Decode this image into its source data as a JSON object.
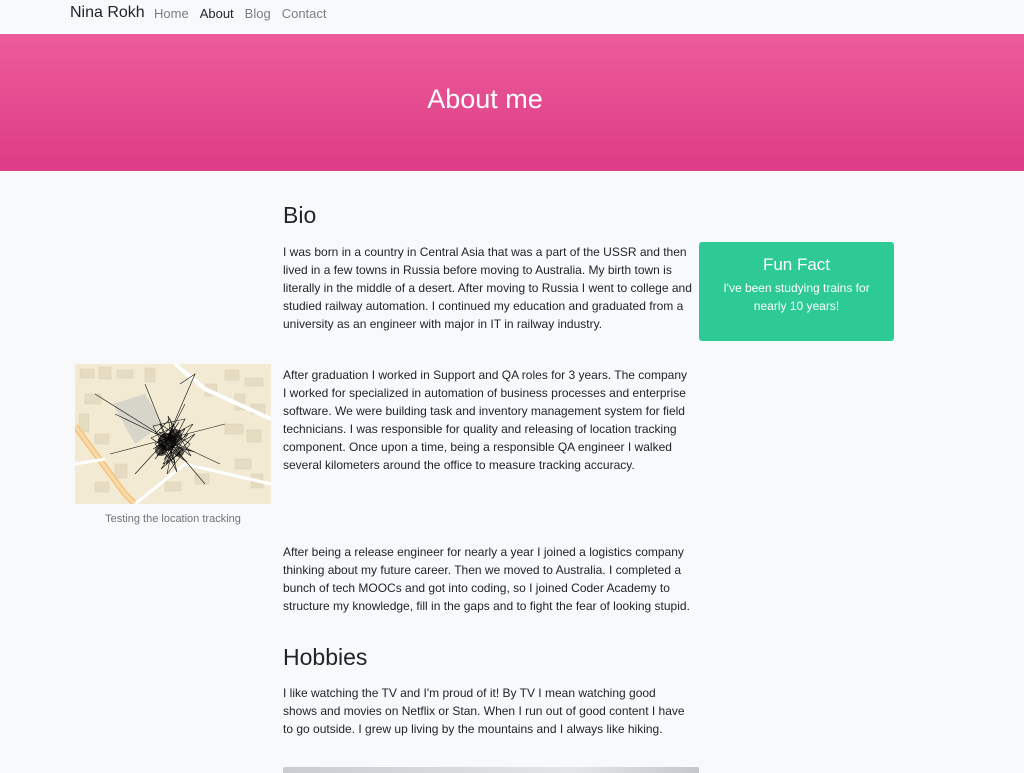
{
  "nav": {
    "brand": "Nina Rokh",
    "links": [
      {
        "label": "Home",
        "active": false
      },
      {
        "label": "About",
        "active": true
      },
      {
        "label": "Blog",
        "active": false
      },
      {
        "label": "Contact",
        "active": false
      }
    ]
  },
  "hero": {
    "title": "About me",
    "colors": [
      "#ec5b9a",
      "#dd3c86"
    ]
  },
  "bio": {
    "title": "Bio",
    "paragraphs": [
      "I was born in a country in Central Asia that was a part of the USSR and then lived in a few towns in Russia before moving to Australia. My birth town is literally in the middle of a desert. After moving to Russia I went to college and studied railway automation. I continued my education and graduated from a university as an engineer with major in IT in railway industry.",
      "After graduation I worked in Support and QA roles for 3 years. The company I worked for specialized in automation of business processes and enterprise software. We were building task and inventory management system for field technicians. I was responsible for quality and releasing of location tracking component. Once upon a time, being a responsible QA engineer I walked several kilometers around the office to measure tracking accuracy.",
      "After being a release engineer for nearly a year I joined a logistics company thinking about my future career. Then we moved to Australia. I completed a bunch of tech MOOCs and got into coding, so I joined Coder Academy to structure my knowledge, fill in the gaps and to fight the fear of looking stupid."
    ]
  },
  "fun_fact": {
    "title": "Fun Fact",
    "text": "I've been studying trains for nearly 10 years!",
    "color": "#2dca96"
  },
  "figure": {
    "caption": "Testing the location tracking"
  },
  "hobbies": {
    "title": "Hobbies",
    "paragraph": "I like watching the TV and I'm proud of it! By TV I mean watching good shows and movies on Netflix or Stan. When I run out of good content I have to go outside. I grew up living by the mountains and I always like hiking."
  }
}
